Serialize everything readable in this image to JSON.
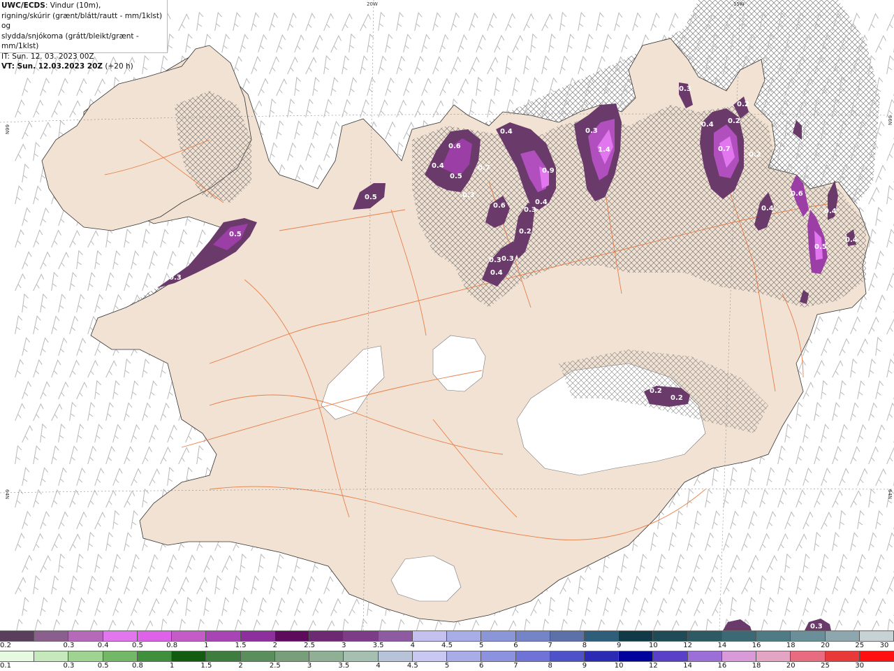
{
  "header": {
    "title": "UWC/ECDS",
    "description_line1": ": Vindur (10m),",
    "description_line2": "rigning/skúrir (grænt/blátt/rautt - mm/1klst) og",
    "description_line3": "slydda/snjókoma (grátt/bleikt/grænt - mm/1klst)",
    "initial_time": "IT: Sun. 12. 03. 2023 00Z",
    "valid_prefix": "VT: Sun. 12.03.2023 20Z",
    "valid_suffix": "(+20 h)"
  },
  "map": {
    "coord_labels": {
      "lon_20w": "20W",
      "lon_15w": "15W",
      "lat_66n_left": "66N",
      "lat_66n_right": "66N",
      "lat_64n_left": "64N",
      "lat_64n_right": "64N"
    },
    "precip_labels": [
      "0.5",
      "0.6",
      "0.4",
      "0.5",
      "0.3",
      "0.7",
      "0.4",
      "0.9",
      "0.3",
      "1.4",
      "0.3",
      "0.4",
      "0.7",
      "0.2",
      "0.2",
      "0.4",
      "0.6",
      "0.4",
      "0.2",
      "0.5",
      "0.3",
      "0.3",
      "0.4",
      "0.6",
      "0.4",
      "0.2",
      "0.3",
      "0.5",
      "0.2",
      "0.2",
      "0.3",
      "0.4",
      "0.3"
    ],
    "colors": {
      "land": "#f1e2d3",
      "road": "#e8743a",
      "sea": "#ffffff",
      "precip_dark": "#6a3a6a",
      "precip_mid": "#9b3fa6",
      "precip_light": "#d870e8"
    }
  },
  "legend": {
    "snow_scale": {
      "labels": [
        "0.2",
        "0.3",
        "0.4",
        "0.5",
        "0.8",
        "1",
        "1.5",
        "2",
        "2.5",
        "3",
        "3.5",
        "4",
        "4.5",
        "5",
        "6",
        "7",
        "8",
        "9",
        "10",
        "12",
        "14",
        "16",
        "18",
        "20",
        "25",
        "30"
      ],
      "colors": [
        "#5a3f5c",
        "#8a5f8d",
        "#b56ab9",
        "#e176ef",
        "#dd62e8",
        "#c45cc7",
        "#a944b5",
        "#8d2f9c",
        "#5e0a5d",
        "#6d2a73",
        "#7c3c88",
        "#8e5ba2",
        "#c4c0f0",
        "#a8ade8",
        "#8b96d8",
        "#7484c6",
        "#5c71a8",
        "#2f5e7a",
        "#103a47",
        "#1e4b55",
        "#2d5a63",
        "#3b6a74",
        "#4e7b84",
        "#6a8f98",
        "#8ea6ad",
        "#c7d2d4"
      ]
    },
    "rain_scale": {
      "labels": [
        "0.1",
        "0.3",
        "0.5",
        "0.8",
        "1",
        "1.5",
        "2",
        "2.5",
        "3",
        "3.5",
        "4",
        "4.5",
        "5",
        "6",
        "7",
        "8",
        "9",
        "10",
        "12",
        "14",
        "16",
        "18",
        "20",
        "25",
        "30"
      ],
      "colors": [
        "#e6f9e1",
        "#c5e9bb",
        "#9ed392",
        "#72b866",
        "#3f8f3d",
        "#115c11",
        "#3f7d3f",
        "#5a8f5c",
        "#77a07a",
        "#8fb095",
        "#a5c0b0",
        "#b6c3d8",
        "#c8c8f2",
        "#a8ade8",
        "#8d92e0",
        "#6f72d6",
        "#4e52c8",
        "#2a2ab5",
        "#02029c",
        "#5a3fc8",
        "#9b6ed8",
        "#d89ad8",
        "#e4a5c4",
        "#e86b80",
        "#e83838",
        "#ff1010"
      ]
    }
  }
}
